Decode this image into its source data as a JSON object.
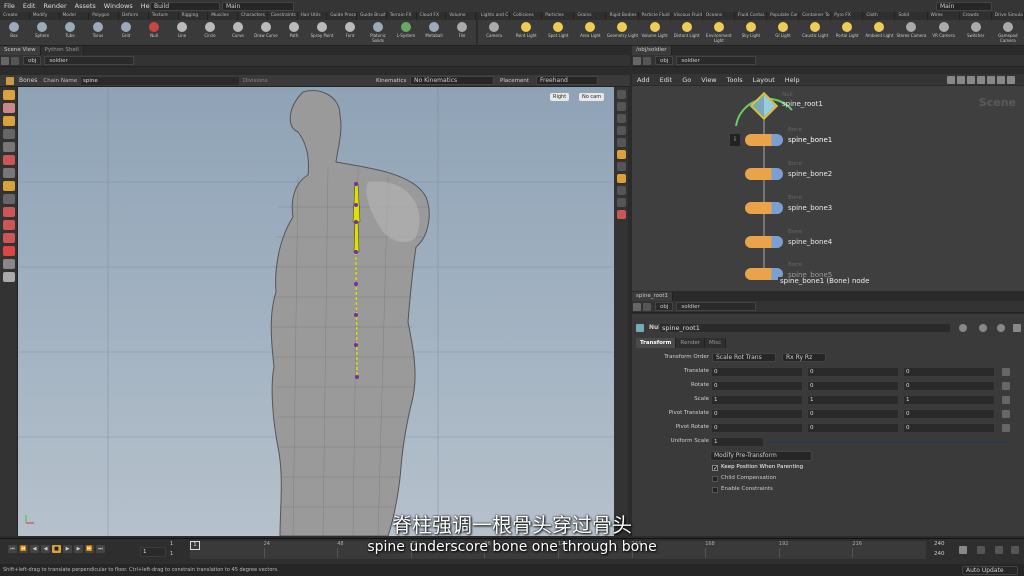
{
  "menubar": {
    "items": [
      "File",
      "Edit",
      "Render",
      "Assets",
      "Windows",
      "Help"
    ],
    "desktop": "Build",
    "context": "Main",
    "right_context": "Main"
  },
  "shelf_left": {
    "tabs": [
      "Create",
      "Modify",
      "Model",
      "Polygon",
      "Deform",
      "Texture",
      "Rigging",
      "Muscles",
      "Characters",
      "Constraints",
      "Hair Utils",
      "Guide Process",
      "Guide Brushes",
      "Terrain FX",
      "Cloud FX",
      "Volume"
    ],
    "tools": [
      {
        "label": "Box",
        "color": "#9ab"
      },
      {
        "label": "Sphere",
        "color": "#9ab"
      },
      {
        "label": "Tube",
        "color": "#9ab"
      },
      {
        "label": "Torus",
        "color": "#9ab"
      },
      {
        "label": "Grid",
        "color": "#9ab"
      },
      {
        "label": "Null",
        "color": "#c44"
      },
      {
        "label": "Line",
        "color": "#bbb"
      },
      {
        "label": "Circle",
        "color": "#bbb"
      },
      {
        "label": "Curve",
        "color": "#bbb"
      },
      {
        "label": "Draw Curve",
        "color": "#bbb"
      },
      {
        "label": "Path",
        "color": "#bbb"
      },
      {
        "label": "Spray Paint",
        "color": "#bbb"
      },
      {
        "label": "Font",
        "color": "#bbb"
      },
      {
        "label": "Platonic Solids",
        "color": "#9ab"
      },
      {
        "label": "L-System",
        "color": "#6a6"
      },
      {
        "label": "Metaball",
        "color": "#9ab"
      },
      {
        "label": "File",
        "color": "#aaa"
      }
    ]
  },
  "shelf_right": {
    "tabs": [
      "Lights and C...",
      "Collisions",
      "Particles",
      "Grains",
      "Rigid Bodies",
      "Particle Fluids",
      "Viscous Fluids",
      "Oceans",
      "Fluid Contai...",
      "Populate Con...",
      "Container Tools",
      "Pyro FX",
      "Cloth",
      "Solid",
      "Wires",
      "Crowds",
      "Drive Simula..."
    ],
    "tools": [
      {
        "label": "Camera",
        "color": "#aaa"
      },
      {
        "label": "Point Light",
        "color": "#ec5"
      },
      {
        "label": "Spot Light",
        "color": "#ec5"
      },
      {
        "label": "Area Light",
        "color": "#ec5"
      },
      {
        "label": "Geometry Light",
        "color": "#ec5"
      },
      {
        "label": "Volume Light",
        "color": "#ec5"
      },
      {
        "label": "Distant Light",
        "color": "#ec5"
      },
      {
        "label": "Environment Light",
        "color": "#ec5"
      },
      {
        "label": "Sky Light",
        "color": "#ec5"
      },
      {
        "label": "GI Light",
        "color": "#ec5"
      },
      {
        "label": "Caustic Light",
        "color": "#ec5"
      },
      {
        "label": "Portal Light",
        "color": "#ec5"
      },
      {
        "label": "Ambient Light",
        "color": "#ec5"
      },
      {
        "label": "Stereo Camera",
        "color": "#aaa"
      },
      {
        "label": "VR Camera",
        "color": "#aaa"
      },
      {
        "label": "Switcher",
        "color": "#aaa"
      },
      {
        "label": "Gamepad Camera",
        "color": "#aaa"
      }
    ]
  },
  "viewer": {
    "tabs": [
      "Scene View",
      "Python Shell"
    ],
    "path": [
      "obj",
      "soldier"
    ],
    "bones_tool": {
      "label": "Bones",
      "chain_label": "Chain Name",
      "chain_value": "spine",
      "divisions_label": "Divisions",
      "kinematics_label": "Kinematics",
      "kinematics_value": "No Kinematics",
      "placement_label": "Placement",
      "placement_value": "Freehand"
    },
    "view_buttons": [
      "Right",
      "No cam"
    ]
  },
  "network": {
    "tab": "/obj/soldier",
    "path": [
      "obj",
      "soldier"
    ],
    "menu": [
      "Add",
      "Edit",
      "Go",
      "View",
      "Tools",
      "Layout",
      "Help"
    ],
    "watermark": "Scene",
    "nodes": [
      {
        "type": "Null",
        "name": "spine_root1"
      },
      {
        "type": "Bone",
        "name": "spine_bone1"
      },
      {
        "type": "Bone",
        "name": "spine_bone2"
      },
      {
        "type": "Bone",
        "name": "spine_bone3"
      },
      {
        "type": "Bone",
        "name": "spine_bone4"
      },
      {
        "type": "Bone",
        "name": "spine_bone5"
      }
    ],
    "tooltip": "spine_bone1 (Bone) node"
  },
  "params": {
    "tab": "spine_root1",
    "path": [
      "obj",
      "soldier"
    ],
    "node_type": "Null",
    "node_name": "spine_root1",
    "tabs": [
      "Transform",
      "Render",
      "Misc"
    ],
    "transform_order_label": "Transform Order",
    "transform_order": "Scale Rot Trans",
    "rot_order": "Rx Ry Rz",
    "rows": [
      {
        "label": "Translate",
        "x": "0",
        "y": "0",
        "z": "0"
      },
      {
        "label": "Rotate",
        "x": "0",
        "y": "0",
        "z": "0"
      },
      {
        "label": "Scale",
        "x": "1",
        "y": "1",
        "z": "1"
      },
      {
        "label": "Pivot Translate",
        "x": "0",
        "y": "0",
        "z": "0"
      },
      {
        "label": "Pivot Rotate",
        "x": "0",
        "y": "0",
        "z": "0"
      }
    ],
    "uniform_scale_label": "Uniform Scale",
    "uniform_scale": "1",
    "modify_pre": "Modify Pre-Transform",
    "checks": [
      {
        "label": "Keep Position When Parenting",
        "checked": true
      },
      {
        "label": "Child Compensation",
        "checked": false
      },
      {
        "label": "Enable Constraints",
        "checked": false
      }
    ]
  },
  "timeline": {
    "frame": "1",
    "start": "1",
    "start2": "1",
    "end": "240",
    "end2": "240",
    "ticks": [
      "1",
      "24",
      "48",
      "72",
      "96",
      "120",
      "144",
      "168",
      "192",
      "216",
      "240"
    ],
    "current": "1"
  },
  "status": {
    "text": "Shift+left-drag to translate perpendicular to floor. Ctrl+left-drag to constrain translation to 45 degree vectors.",
    "auto_update": "Auto Update"
  },
  "subtitles": {
    "chinese": "脊柱强调一根骨头穿过骨头",
    "english": "spine underscore bone one through bone"
  }
}
